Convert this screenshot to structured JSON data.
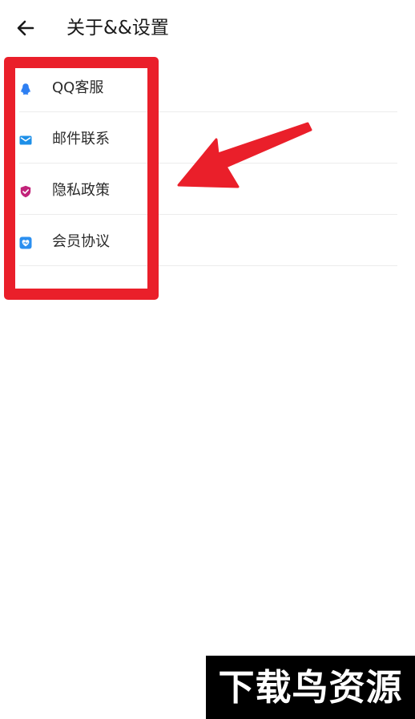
{
  "header": {
    "title": "关于&&设置",
    "back_icon": "arrow-left-icon"
  },
  "menu": {
    "items": [
      {
        "label": "QQ客服",
        "icon": "qq-penguin-icon",
        "icon_color": "#2e7ff2"
      },
      {
        "label": "邮件联系",
        "icon": "mail-icon",
        "icon_color": "#1d8fe8"
      },
      {
        "label": "隐私政策",
        "icon": "shield-check-icon",
        "icon_color": "#c2237a"
      },
      {
        "label": "会员协议",
        "icon": "member-badge-icon",
        "icon_color": "#2b8ff0"
      }
    ]
  },
  "annotation": {
    "highlight_color": "#ea1f2a"
  },
  "watermark": {
    "text": "下载鸟资源"
  }
}
